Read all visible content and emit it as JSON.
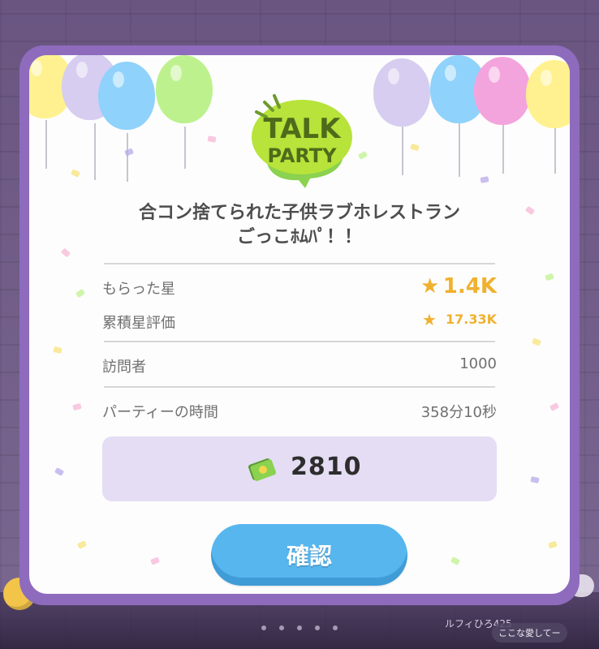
{
  "logo": {
    "talk": "TALK",
    "party": "PARTY"
  },
  "title": {
    "line1": "合コン捨てられた子供ラブホレストラン",
    "line2": "ごっこﾎﾑﾊﾟ！！"
  },
  "stats": {
    "received_stars_label": "もらった星",
    "received_stars_value": "1.4K",
    "cumulative_rating_label": "累積星評価",
    "cumulative_rating_value": "17.33K",
    "visitors_label": "訪問者",
    "visitors_value": "1000",
    "party_time_label": "パーティーの時間",
    "party_time_value": "358分10秒"
  },
  "reward": {
    "amount": "2810",
    "icon": "money-icon"
  },
  "confirm_label": "確認",
  "background": {
    "username_partial": "ルフィひろ425",
    "chat_chip": "ここな愛してー"
  },
  "colors": {
    "frame": "#8e6bbd",
    "button": "#58b6ee",
    "star": "#f0b12f",
    "reward_bg": "#e4ddf4"
  }
}
